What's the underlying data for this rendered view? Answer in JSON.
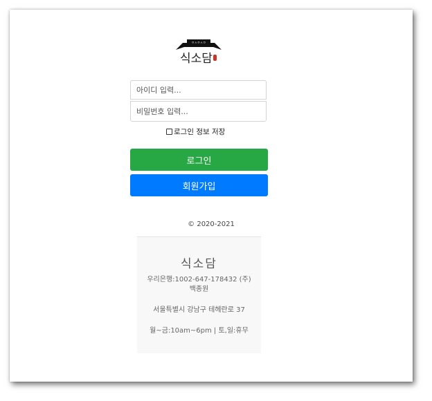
{
  "logo": {
    "name": "식소담",
    "banner_text": "ㅇㅅㅇㅅㅇ",
    "dot_color": "#c0392b"
  },
  "login_form": {
    "id_placeholder": "아이디 입력...",
    "password_placeholder": "비밀번호 입력...",
    "remember_label": "로그인 정보 저장",
    "remember_checked": false,
    "login_button": "로그인",
    "signup_button": "회원가입"
  },
  "colors": {
    "login_button": "#28a745",
    "signup_button": "#007bff"
  },
  "footer": {
    "copyright": "© 2020-2021",
    "title": "식소담",
    "bank": "우리은행:1002-647-178432 (주)백종원",
    "address": "서울특별시 강남구 테헤란로 37",
    "hours": "월~금:10am~6pm | 토,일:휴무"
  }
}
